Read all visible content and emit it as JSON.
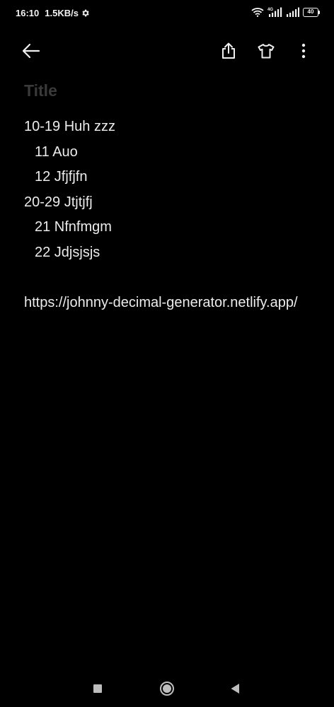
{
  "status_bar": {
    "time": "16:10",
    "net_speed": "1.5KB/s",
    "network_label": "4G",
    "battery_level": "40",
    "icons": [
      "settings-icon",
      "wifi-icon",
      "signal-4g-icon",
      "signal-icon",
      "battery-icon"
    ]
  },
  "toolbar": {
    "icons": [
      "back-arrow-icon",
      "share-icon",
      "theme-shirt-icon",
      "more-vertical-icon"
    ]
  },
  "note": {
    "title_placeholder": "Title",
    "lines": [
      "10-19 Huh zzz",
      "11 Auo",
      "12 Jfjfjfn",
      "20-29 Jtjtjfj",
      "21 Nfnfmgm",
      "22 Jdjsjsjs"
    ],
    "link": "https://johnny-decimal-generator.netlify.app/"
  },
  "nav_bar": {
    "icons": [
      "recents-square-icon",
      "home-circle-icon",
      "back-triangle-icon"
    ]
  },
  "colors": {
    "background": "#000000",
    "text": "#ececec",
    "title_placeholder": "#3a3a3a"
  }
}
